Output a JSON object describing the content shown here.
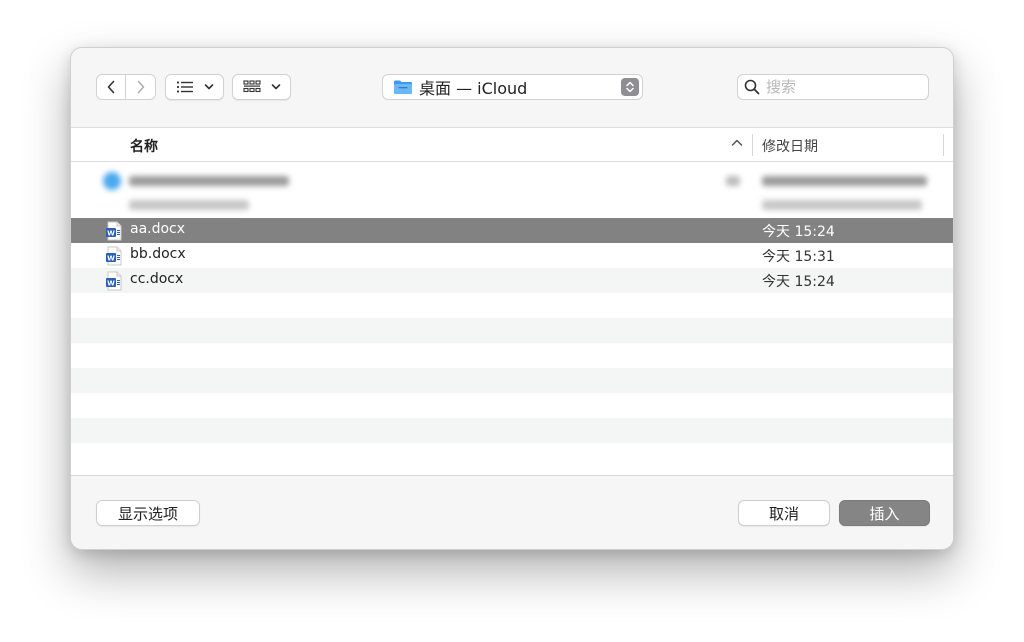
{
  "toolbar": {
    "location_label": "桌面 — iCloud",
    "search_placeholder": "搜索"
  },
  "columns": {
    "name": "名称",
    "modified": "修改日期"
  },
  "files": [
    {
      "name": "aa.docx",
      "modified": "今天 15:24",
      "selected": true
    },
    {
      "name": "bb.docx",
      "modified": "今天 15:31",
      "selected": false
    },
    {
      "name": "cc.docx",
      "modified": "今天 15:24",
      "selected": false
    }
  ],
  "footer": {
    "options_label": "显示选项",
    "cancel_label": "取消",
    "insert_label": "插入"
  },
  "colors": {
    "selection": "#828282",
    "folder": "#3d9ae8",
    "word_blue": "#2b5fb8"
  }
}
